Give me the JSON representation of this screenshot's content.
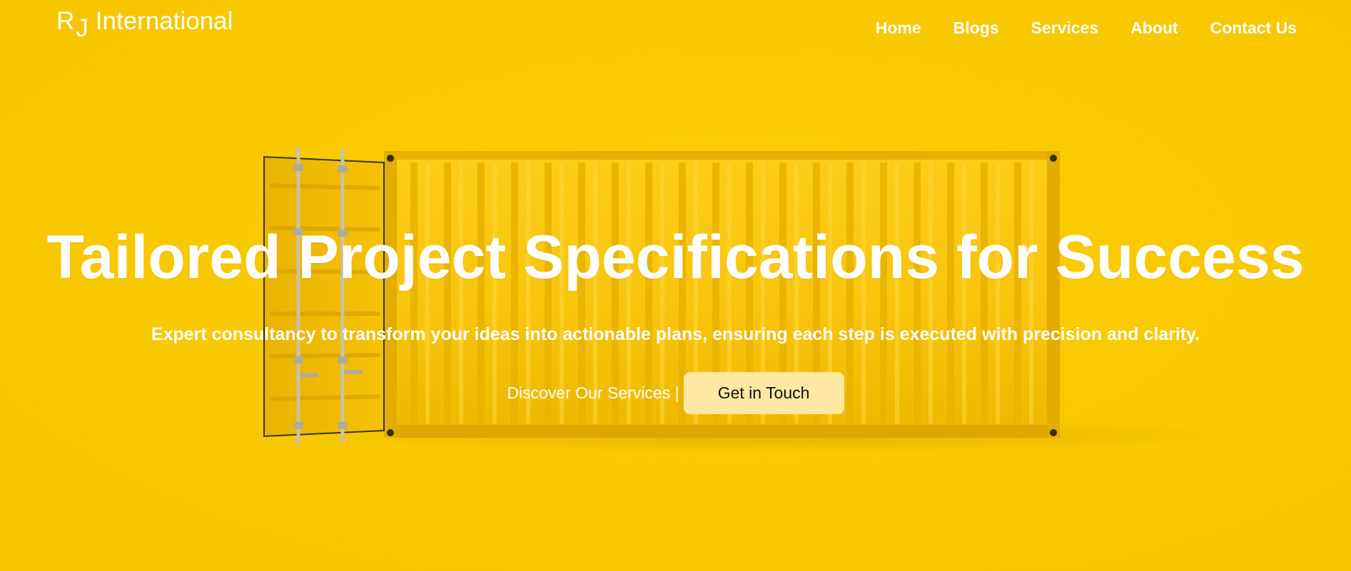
{
  "header": {
    "logo_initial_1": "R",
    "logo_initial_2": "J",
    "logo_name": "International",
    "nav": [
      {
        "label": "Home"
      },
      {
        "label": "Blogs"
      },
      {
        "label": "Services"
      },
      {
        "label": "About"
      },
      {
        "label": "Contact Us"
      }
    ]
  },
  "hero": {
    "title": "Tailored Project Specifications for Success",
    "subtitle": "Expert consultancy to transform your ideas into actionable plans, ensuring each step is executed with precision and clarity.",
    "cta_text": "Discover Our Services |",
    "cta_button": "Get in Touch"
  },
  "colors": {
    "background": "#f8c800",
    "text": "#ffffff",
    "button_bg": "#ffe8a3",
    "button_text": "#111111"
  }
}
